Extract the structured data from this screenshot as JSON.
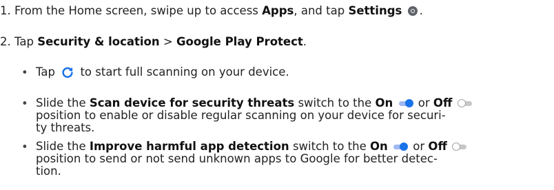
{
  "step1": {
    "number": "1.",
    "text_a": "From the Home screen, swipe up to access",
    "apps": "Apps",
    "text_b": ", and tap",
    "settings": "Settings",
    "text_end": "."
  },
  "step2": {
    "number": "2.",
    "text_a": "Tap",
    "security_location": "Security & location",
    "separator": ">",
    "play_protect": "Google Play Protect",
    "text_end": "."
  },
  "bullets": {
    "marker": "•",
    "b1": {
      "tap": "Tap",
      "rest": "to start full scanning on your device."
    },
    "b2": {
      "slide": "Slide the",
      "switch_name": "Scan device for security threats",
      "mid": "switch to the",
      "on": "On",
      "or": "or",
      "off": "Off",
      "line2": "position to enable or disable regular scanning on your device for securi-",
      "line3": "ty threats."
    },
    "b3": {
      "slide": "Slide the",
      "switch_name": "Improve harmful app detection",
      "mid": "switch to the",
      "on": "On",
      "or": "or",
      "off": "Off",
      "line2": "position to send or not send unknown apps to Google for better detec-",
      "line3": "tion."
    }
  },
  "colors": {
    "accent": "#1a73e8",
    "text": "#222222"
  },
  "icons": {
    "settings": "gear-icon",
    "scan": "refresh-icon",
    "switch_on": "toggle-on-icon",
    "switch_off": "toggle-off-icon"
  }
}
